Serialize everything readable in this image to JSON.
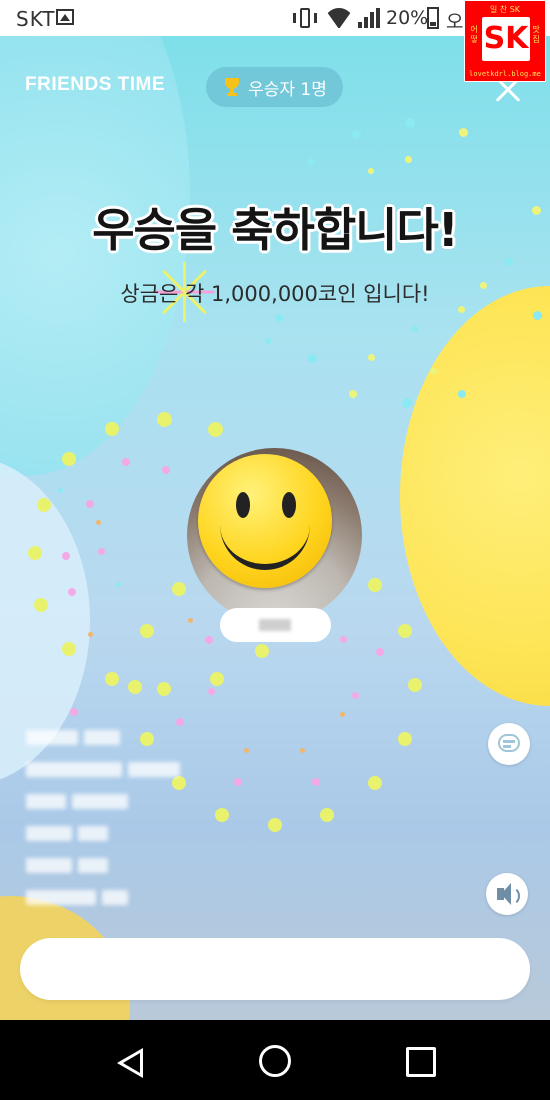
{
  "status_bar": {
    "carrier": "SKT",
    "gallery_icon": "gallery-icon",
    "vibrate_icon": "vibrate-icon",
    "wifi_icon": "wifi-icon",
    "signal_icon": "signal-icon",
    "battery_percent": "20%",
    "battery_icon": "battery-icon",
    "time": "오전"
  },
  "watermark": {
    "top_text": "일 찬 SK",
    "logo": "SK",
    "side_left": "어 떻",
    "side_right": "맛 집",
    "url": "lovetkdrl.blog.me"
  },
  "header": {
    "app_title": "FRIENDS TIME",
    "winners_label": "우승자 1명",
    "trophy_icon": "trophy-icon",
    "close_icon": "close-icon"
  },
  "main": {
    "headline": "우승을 축하합니다!",
    "subhead": "상금은 각 1,000,000코인 입니다!"
  },
  "winner": {
    "avatar_icon": "smiley-face-icon"
  },
  "controls": {
    "chat_icon": "chat-bubble-icon",
    "sound_icon": "speaker-icon"
  },
  "nav": {
    "back_icon": "nav-back-icon",
    "home_icon": "nav-home-icon",
    "recent_icon": "nav-recents-icon"
  },
  "colors": {
    "background_cyan": "#7ee0ea",
    "blob_yellow": "#fde556",
    "headline_text": "#141414",
    "pill_bg": "#6ec3d6",
    "nav_bg": "#000000"
  }
}
